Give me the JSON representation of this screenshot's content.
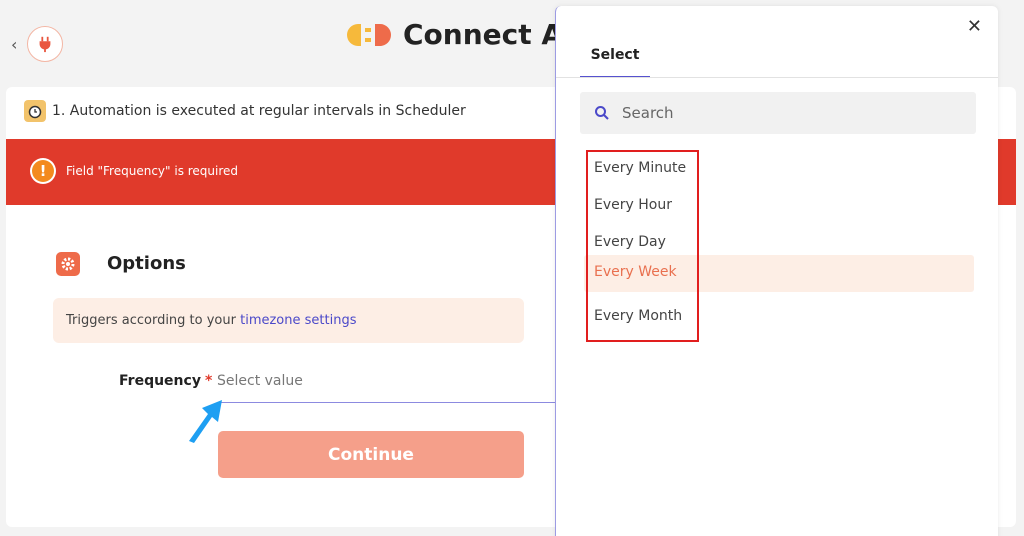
{
  "header": {
    "back_icon": "chevron-left-icon",
    "plug_icon": "plug-icon",
    "app_title": "Connect A"
  },
  "step": {
    "icon": "alarm-clock-icon",
    "text": "1. Automation is executed at regular intervals in Scheduler"
  },
  "error": {
    "icon": "exclamation-icon",
    "message": "Field \"Frequency\" is required"
  },
  "options": {
    "icon": "gear-icon",
    "title": "Options",
    "note_prefix": "Triggers according to your ",
    "note_link": "timezone settings"
  },
  "frequency": {
    "label": "Frequency",
    "required_mark": "*",
    "placeholder": "Select value"
  },
  "continue_label": "Continue",
  "dropdown": {
    "close_icon": "close-icon",
    "tab_label": "Select",
    "search_placeholder": "Search",
    "options": [
      {
        "label": "Every Minute",
        "highlighted": false
      },
      {
        "label": "Every Hour",
        "highlighted": false
      },
      {
        "label": "Every Day",
        "highlighted": false
      },
      {
        "label": "Every Week",
        "highlighted": true
      },
      {
        "label": "Every Month",
        "highlighted": false
      }
    ]
  },
  "colors": {
    "accent": "#ee6b4a",
    "error": "#e03a2b",
    "link": "#4b49c9",
    "highlight_bg": "#fdeee5",
    "annotation_arrow": "#1e9ff2",
    "annotation_box": "#e11e1e"
  }
}
